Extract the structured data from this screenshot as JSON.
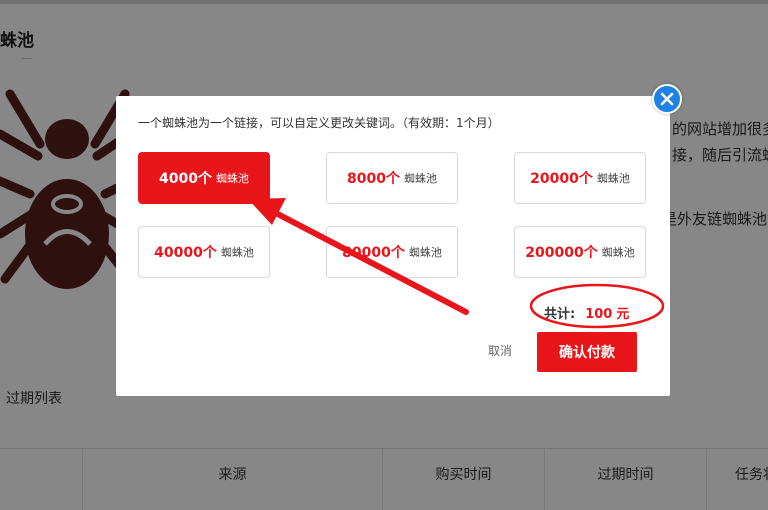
{
  "background": {
    "page_title": "蛛池",
    "text_line_1": "的网站增加很多",
    "text_line_2": "接，随后引流蜘",
    "text_line_3": "是外友链蜘蛛池",
    "tab_label": "过期列表",
    "table_headers": [
      "来源",
      "购买时间",
      "过期时间",
      "任务状"
    ]
  },
  "modal": {
    "description": "一个蜘蛛池为一个链接，可以自定义更改关键词。（有效期：1个月）",
    "options": [
      {
        "count": "4000个",
        "unit": "蜘蛛池",
        "selected": true
      },
      {
        "count": "8000个",
        "unit": "蜘蛛池",
        "selected": false
      },
      {
        "count": "20000个",
        "unit": "蜘蛛池",
        "selected": false
      },
      {
        "count": "40000个",
        "unit": "蜘蛛池",
        "selected": false
      },
      {
        "count": "80000个",
        "unit": "蜘蛛池",
        "selected": false
      },
      {
        "count": "200000个",
        "unit": "蜘蛛池",
        "selected": false
      }
    ],
    "total_label": "共计:",
    "total_amount": "100",
    "total_currency": "元",
    "cancel_label": "取消",
    "confirm_label": "确认付款"
  },
  "colors": {
    "accent_red": "#e8151b",
    "close_blue": "#1e82e6",
    "spider_brown": "#5a1f1f"
  },
  "icons": {
    "close": "close-icon",
    "mascot": "spider-icon"
  }
}
